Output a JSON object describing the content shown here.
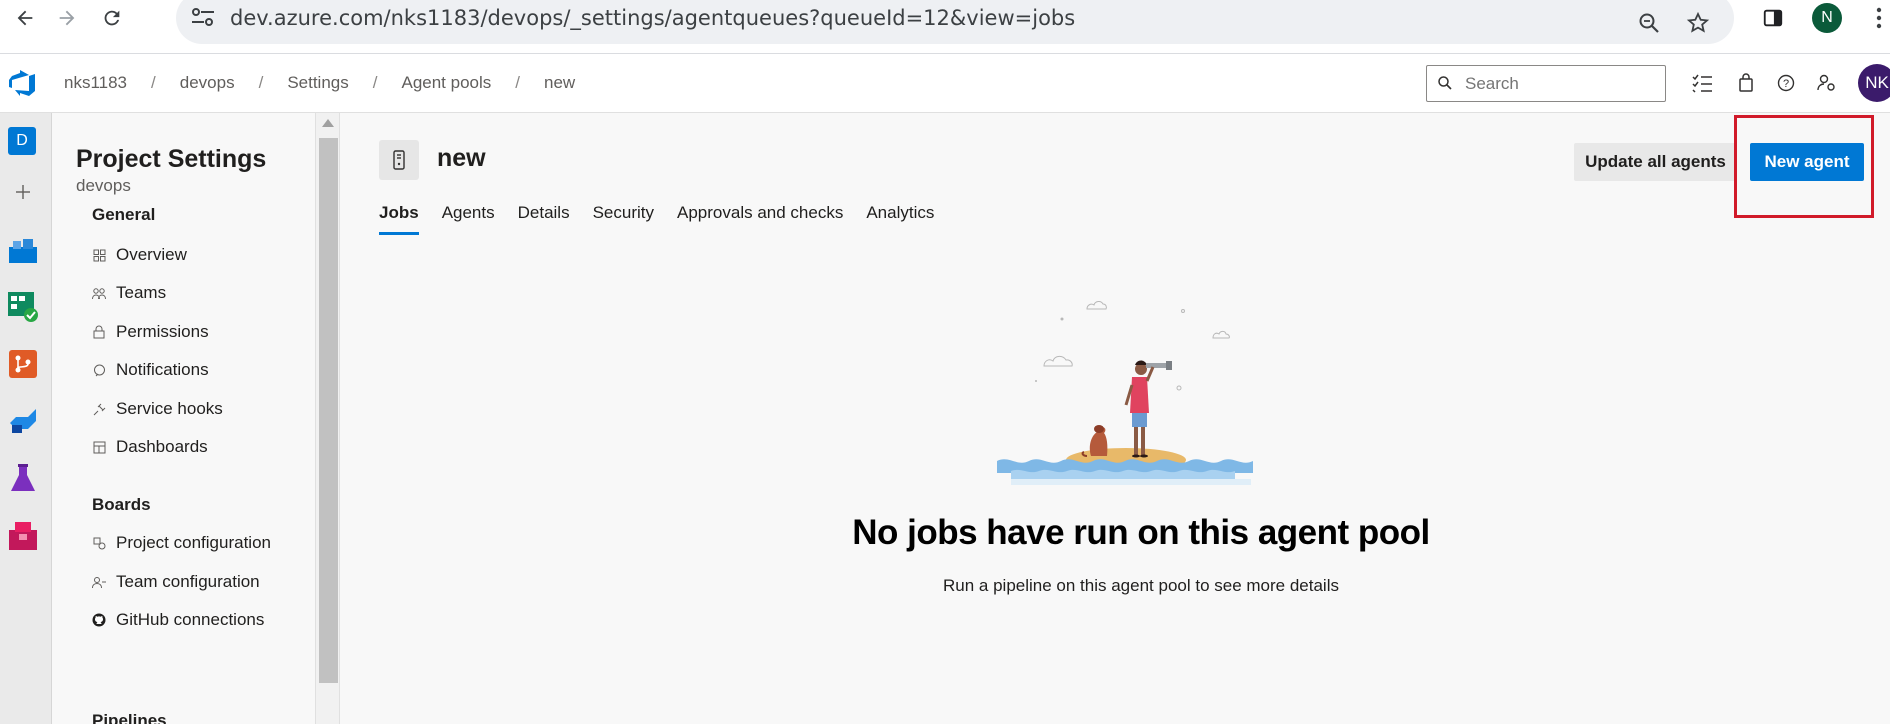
{
  "browser": {
    "url": "dev.azure.com/nks1183/devops/_settings/agentqueues?queueId=12&view=jobs",
    "profile_initial": "N"
  },
  "header": {
    "breadcrumbs": [
      "nks1183",
      "devops",
      "Settings",
      "Agent pools",
      "new"
    ],
    "search_placeholder": "Search",
    "avatar_initials": "NK"
  },
  "rail": {
    "project_initial": "D"
  },
  "settings": {
    "title": "Project Settings",
    "subtitle": "devops",
    "groups": [
      {
        "label": "General",
        "items": [
          {
            "label": "Overview",
            "icon": "overview-icon"
          },
          {
            "label": "Teams",
            "icon": "teams-icon"
          },
          {
            "label": "Permissions",
            "icon": "lock-icon"
          },
          {
            "label": "Notifications",
            "icon": "notification-icon"
          },
          {
            "label": "Service hooks",
            "icon": "plug-icon"
          },
          {
            "label": "Dashboards",
            "icon": "dashboard-icon"
          }
        ]
      },
      {
        "label": "Boards",
        "items": [
          {
            "label": "Project configuration",
            "icon": "config-icon"
          },
          {
            "label": "Team configuration",
            "icon": "team-config-icon"
          },
          {
            "label": "GitHub connections",
            "icon": "github-icon"
          }
        ]
      },
      {
        "label": "Pipelines",
        "items": []
      }
    ]
  },
  "main": {
    "pool_name": "new",
    "update_button": "Update all agents",
    "new_agent_button": "New agent",
    "tabs": [
      "Jobs",
      "Agents",
      "Details",
      "Security",
      "Approvals and checks",
      "Analytics"
    ],
    "active_tab": "Jobs",
    "empty_title": "No jobs have run on this agent pool",
    "empty_subtitle": "Run a pipeline on this agent pool to see more details"
  },
  "colors": {
    "accent": "#0078d4",
    "highlight": "#d11a2a"
  }
}
